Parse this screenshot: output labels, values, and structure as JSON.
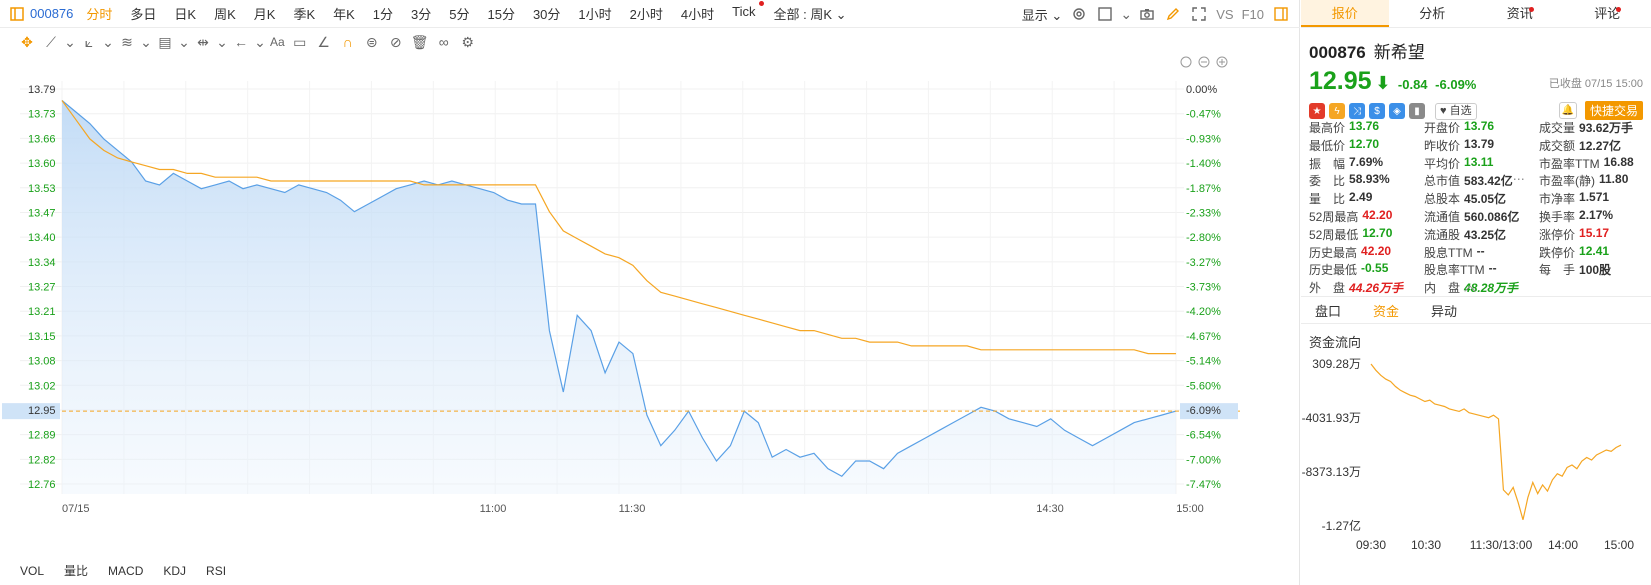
{
  "toolbar": {
    "code": "000876",
    "periods": [
      "分时",
      "多日",
      "日K",
      "周K",
      "月K",
      "季K",
      "年K",
      "1分",
      "3分",
      "5分",
      "15分",
      "30分",
      "1小时",
      "2小时",
      "4小时",
      "Tick"
    ],
    "active_period": "分时",
    "all_label": "全部 : 周K",
    "display_label": "显示",
    "vs_label": "VS",
    "f10_label": "F10"
  },
  "drawing_tools": {
    "text_tool": "Aa"
  },
  "indicators": [
    "VOL",
    "量比",
    "MACD",
    "KDJ",
    "RSI"
  ],
  "chart_data": {
    "type": "line",
    "y_left_ticks": [
      "13.79",
      "13.73",
      "13.66",
      "13.60",
      "13.53",
      "13.47",
      "13.40",
      "13.34",
      "13.27",
      "13.21",
      "13.15",
      "13.08",
      "13.02",
      "12.95",
      "12.89",
      "12.82",
      "12.76"
    ],
    "y_right_ticks": [
      "0.00%",
      "-0.47%",
      "-0.93%",
      "-1.40%",
      "-1.87%",
      "-2.33%",
      "-2.80%",
      "-3.27%",
      "-3.73%",
      "-4.20%",
      "-4.67%",
      "-5.14%",
      "-5.60%",
      "-6.09%",
      "-6.54%",
      "-7.00%",
      "-7.47%"
    ],
    "x_ticks": [
      "07/15",
      "11:00",
      "11:30",
      "14:30",
      "15:00"
    ],
    "ylim": [
      12.76,
      13.79
    ],
    "prev_close": 13.79,
    "last_price_label": "12.95",
    "last_pct_label": "-6.09%",
    "series": [
      {
        "kind": "price",
        "color": "#5aa0e6",
        "values": [
          13.76,
          13.73,
          13.7,
          13.66,
          13.63,
          13.6,
          13.55,
          13.54,
          13.57,
          13.55,
          13.53,
          13.54,
          13.55,
          13.53,
          13.54,
          13.53,
          13.52,
          13.54,
          13.53,
          13.52,
          13.5,
          13.47,
          13.49,
          13.51,
          13.53,
          13.54,
          13.55,
          13.54,
          13.55,
          13.54,
          13.53,
          13.52,
          13.5,
          13.49,
          13.49,
          13.16,
          13.0,
          13.2,
          13.16,
          13.05,
          13.13,
          13.1,
          12.94,
          12.86,
          12.9,
          12.95,
          12.88,
          12.82,
          12.86,
          12.95,
          12.92,
          12.83,
          12.85,
          12.83,
          12.84,
          12.8,
          12.78,
          12.82,
          12.82,
          12.8,
          12.84,
          12.86,
          12.88,
          12.9,
          12.92,
          12.94,
          12.96,
          12.95,
          12.93,
          12.92,
          12.91,
          12.93,
          12.9,
          12.88,
          12.86,
          12.88,
          12.9,
          12.92,
          12.93,
          12.94,
          12.95
        ]
      },
      {
        "kind": "avg",
        "color": "#f5a623",
        "values": [
          13.76,
          13.71,
          13.66,
          13.63,
          13.61,
          13.6,
          13.59,
          13.58,
          13.58,
          13.57,
          13.57,
          13.56,
          13.56,
          13.56,
          13.56,
          13.55,
          13.55,
          13.55,
          13.55,
          13.55,
          13.55,
          13.55,
          13.55,
          13.55,
          13.55,
          13.55,
          13.54,
          13.54,
          13.54,
          13.54,
          13.54,
          13.54,
          13.54,
          13.54,
          13.54,
          13.47,
          13.42,
          13.4,
          13.38,
          13.36,
          13.35,
          13.33,
          13.29,
          13.26,
          13.25,
          13.24,
          13.23,
          13.22,
          13.21,
          13.2,
          13.19,
          13.18,
          13.17,
          13.16,
          13.16,
          13.15,
          13.14,
          13.14,
          13.13,
          13.13,
          13.13,
          13.12,
          13.12,
          13.12,
          13.12,
          13.12,
          13.11,
          13.11,
          13.11,
          13.11,
          13.11,
          13.11,
          13.11,
          13.11,
          13.11,
          13.11,
          13.11,
          13.11,
          13.1,
          13.1,
          13.1
        ]
      }
    ]
  },
  "right_tabs": [
    "报价",
    "分析",
    "资讯",
    "评论"
  ],
  "right_tabs_dot": [
    false,
    false,
    true,
    true
  ],
  "quote": {
    "code": "000876",
    "name": "新希望",
    "price": "12.95",
    "arrow": "⬇",
    "change": "-0.84",
    "change_pct": "-6.09%",
    "closed_label": "已收盘 07/15 15:00",
    "watch_label": "自选",
    "trade_label": "快捷交易",
    "badges": [
      {
        "icon": "flag-cn-icon",
        "glyph": "★",
        "color": "#e23b2a"
      },
      {
        "icon": "bolt-icon",
        "glyph": "ϟ",
        "color": "#f5a623"
      },
      {
        "icon": "shuffle-icon",
        "glyph": "⤨",
        "color": "#3b8fe8"
      },
      {
        "icon": "dollar-icon",
        "glyph": "$",
        "color": "#3b8fe8"
      },
      {
        "icon": "tag-icon",
        "glyph": "◈",
        "color": "#3b8fe8"
      },
      {
        "icon": "bookmark-icon",
        "glyph": "▮",
        "color": "#8a8a8a"
      }
    ],
    "stats": [
      [
        {
          "l": "最高价",
          "v": "13.76",
          "c": "green"
        },
        {
          "l": "开盘价",
          "v": "13.76",
          "c": "green"
        },
        {
          "l": "成交量",
          "v": "93.62万手",
          "c": ""
        }
      ],
      [
        {
          "l": "最低价",
          "v": "12.70",
          "c": "green"
        },
        {
          "l": "昨收价",
          "v": "13.79",
          "c": ""
        },
        {
          "l": "成交额",
          "v": "12.27亿",
          "c": ""
        }
      ],
      [
        {
          "l": "振　幅",
          "v": "7.69%",
          "c": ""
        },
        {
          "l": "平均价",
          "v": "13.11",
          "c": "green"
        },
        {
          "l": "市盈率TTM",
          "v": "16.88",
          "c": ""
        }
      ],
      [
        {
          "l": "委　比",
          "v": "58.93%",
          "c": ""
        },
        {
          "l": "总市值",
          "v": "583.42亿",
          "c": ""
        },
        {
          "l": "市盈率(静)",
          "v": "11.80",
          "c": ""
        }
      ],
      [
        {
          "l": "量　比",
          "v": "2.49",
          "c": ""
        },
        {
          "l": "总股本",
          "v": "45.05亿",
          "c": ""
        },
        {
          "l": "市净率",
          "v": "1.571",
          "c": ""
        }
      ],
      [
        {
          "l": "52周最高",
          "v": "42.20",
          "c": "red"
        },
        {
          "l": "流通值",
          "v": "560.086亿",
          "c": ""
        },
        {
          "l": "换手率",
          "v": "2.17%",
          "c": ""
        }
      ],
      [
        {
          "l": "52周最低",
          "v": "12.70",
          "c": "green"
        },
        {
          "l": "流通股",
          "v": "43.25亿",
          "c": ""
        },
        {
          "l": "涨停价",
          "v": "15.17",
          "c": "red"
        }
      ],
      [
        {
          "l": "历史最高",
          "v": "42.20",
          "c": "red"
        },
        {
          "l": "股息TTM",
          "v": "--",
          "c": ""
        },
        {
          "l": "跌停价",
          "v": "12.41",
          "c": "green"
        }
      ],
      [
        {
          "l": "历史最低",
          "v": "-0.55",
          "c": "green"
        },
        {
          "l": "股息率TTM",
          "v": "--",
          "c": ""
        },
        {
          "l": "每　手",
          "v": "100股",
          "c": ""
        }
      ],
      [
        {
          "l": "外　盘",
          "v": "44.26万手",
          "c": "red italic"
        },
        {
          "l": "内　盘",
          "v": "48.28万手",
          "c": "green italic"
        },
        {
          "l": "",
          "v": "",
          "c": ""
        }
      ]
    ]
  },
  "sub_tabs": [
    "盘口",
    "资金",
    "异动"
  ],
  "active_sub_tab": "资金",
  "fund_flow": {
    "title": "资金流向",
    "y_ticks": [
      "309.28万",
      "-4031.93万",
      "-8373.13万",
      "-1.27亿"
    ],
    "x_ticks": [
      "09:30",
      "10:30",
      "11:30/13:00",
      "14:00",
      "15:00"
    ],
    "chart_data": {
      "type": "line",
      "color": "#f5a623",
      "values": [
        309,
        -200,
        -600,
        -900,
        -1100,
        -1500,
        -1800,
        -2000,
        -2200,
        -2300,
        -2500,
        -2700,
        -2600,
        -2900,
        -3000,
        -3100,
        -3300,
        -3400,
        -3500,
        -3300,
        -3600,
        -3700,
        -3800,
        -3900,
        -4000,
        -3800,
        -4100,
        -9800,
        -10200,
        -9600,
        -10800,
        -12200,
        -10400,
        -9200,
        -10100,
        -9400,
        -9900,
        -9000,
        -8500,
        -8700,
        -8000,
        -7800,
        -8100,
        -7500,
        -7200,
        -7400,
        -7000,
        -6800,
        -6600,
        -6700,
        -6400,
        -6200
      ]
    }
  }
}
